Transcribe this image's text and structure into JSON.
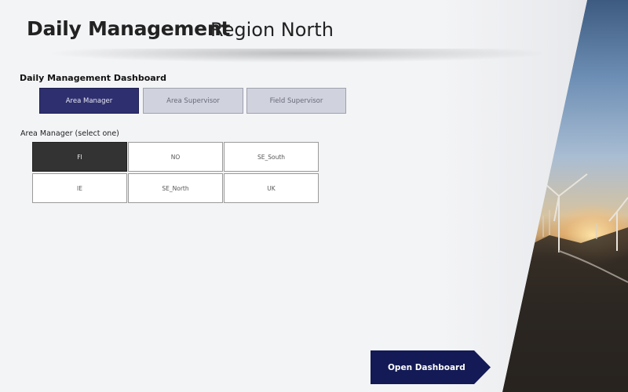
{
  "header": {
    "title": "Daily Management",
    "region": "Region North"
  },
  "dashboard": {
    "section_title": "Daily Management Dashboard",
    "roles": [
      {
        "label": "Area Manager",
        "active": true
      },
      {
        "label": "Area Supervisor",
        "active": false
      },
      {
        "label": "Field Supervisor",
        "active": false
      }
    ],
    "select_label": "Area Manager (select one)",
    "regions": [
      {
        "label": "FI",
        "selected": true
      },
      {
        "label": "NO",
        "selected": false
      },
      {
        "label": "SE_South",
        "selected": false
      },
      {
        "label": "IE",
        "selected": false
      },
      {
        "label": "SE_North",
        "selected": false
      },
      {
        "label": "UK",
        "selected": false
      }
    ]
  },
  "actions": {
    "open_dashboard": "Open Dashboard"
  },
  "colors": {
    "accent": "#2e2f6e",
    "button_dark": "#131a55",
    "selected_region": "#333333"
  }
}
